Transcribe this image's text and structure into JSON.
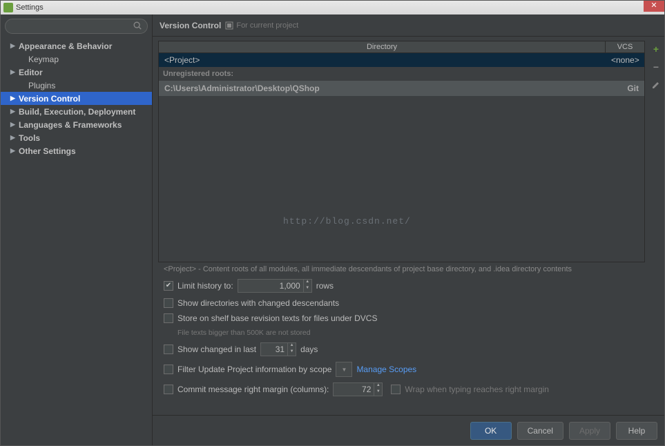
{
  "titlebar": {
    "title": "Settings"
  },
  "search": {
    "placeholder": ""
  },
  "sidebar": {
    "items": [
      {
        "label": "Appearance & Behavior",
        "arrow": true,
        "bold": true
      },
      {
        "label": "Keymap",
        "arrow": false,
        "bold": false,
        "child": true
      },
      {
        "label": "Editor",
        "arrow": true,
        "bold": true
      },
      {
        "label": "Plugins",
        "arrow": false,
        "bold": false,
        "child": true
      },
      {
        "label": "Version Control",
        "arrow": true,
        "bold": true,
        "selected": true
      },
      {
        "label": "Build, Execution, Deployment",
        "arrow": true,
        "bold": true
      },
      {
        "label": "Languages & Frameworks",
        "arrow": true,
        "bold": true
      },
      {
        "label": "Tools",
        "arrow": true,
        "bold": true
      },
      {
        "label": "Other Settings",
        "arrow": true,
        "bold": true
      }
    ]
  },
  "header": {
    "breadcrumb": "Version Control",
    "sub": "For current project"
  },
  "table": {
    "columns": {
      "dir": "Directory",
      "vcs": "VCS"
    },
    "rows": [
      {
        "dir": "<Project>",
        "vcs": "<none>",
        "selected": true
      }
    ],
    "unregistered_label": "Unregistered roots:",
    "unregistered": [
      {
        "dir": "C:\\Users\\Administrator\\Desktop\\QShop",
        "vcs": "Git"
      }
    ]
  },
  "watermark": "http://blog.csdn.net/",
  "options": {
    "project_hint": "<Project> - Content roots of all modules, all immediate descendants of project base directory, and .idea directory contents",
    "limit_history_label": "Limit history to:",
    "limit_history_value": "1,000",
    "limit_history_suffix": "rows",
    "show_dirs_label": "Show directories with changed descendants",
    "store_shelf_label": "Store on shelf base revision texts for files under DVCS",
    "store_shelf_hint": "File texts bigger than 500K are not stored",
    "show_changed_label": "Show changed in last",
    "show_changed_value": "31",
    "show_changed_suffix": "days",
    "filter_scope_label": "Filter Update Project information by scope",
    "manage_scopes": "Manage Scopes",
    "commit_margin_label": "Commit message right margin (columns):",
    "commit_margin_value": "72",
    "wrap_label": "Wrap when typing reaches right margin"
  },
  "footer": {
    "ok": "OK",
    "cancel": "Cancel",
    "apply": "Apply",
    "help": "Help"
  }
}
